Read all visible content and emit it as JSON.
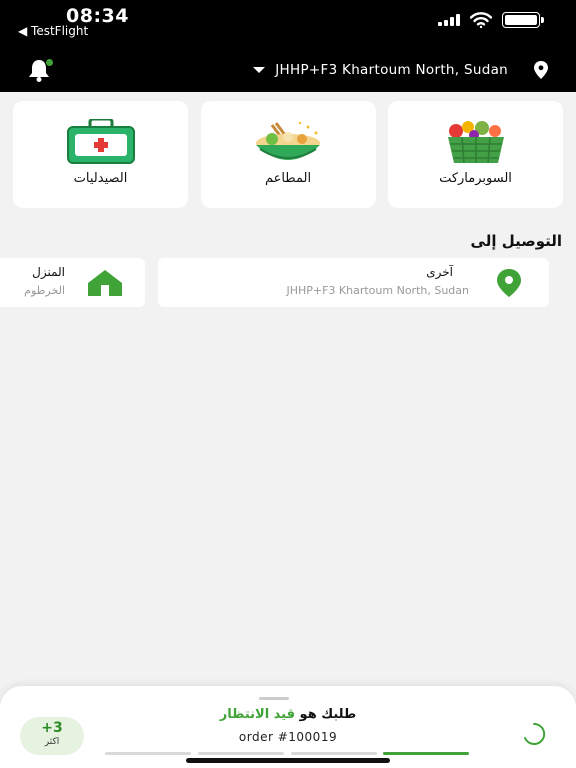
{
  "status_bar": {
    "time": "08:34",
    "back_label": "◀ TestFlight"
  },
  "header": {
    "location": "JHHP+F3 Khartoum North, Sudan",
    "notification_badge_color": "#3fa337"
  },
  "categories": [
    {
      "label": "الصيدليات",
      "icon": "first-aid-kit"
    },
    {
      "label": "المطاعم",
      "icon": "food-bowl"
    },
    {
      "label": "السوبرماركت",
      "icon": "grocery-basket"
    }
  ],
  "delivery": {
    "title": "التوصيل إلى",
    "addresses": [
      {
        "name": "آخرى",
        "detail": "JHHP+F3 Khartoum North, Sudan",
        "icon": "map-pin"
      },
      {
        "name": "المنزل",
        "detail": "الخرطوم",
        "icon": "home"
      }
    ]
  },
  "order_sheet": {
    "prefix": "طلبك هو",
    "status": "قيد الانتظار",
    "order_label": "order #100019",
    "more_count": "+3",
    "more_label": "اكثر",
    "progress_colors": [
      "#d9d9d9",
      "#d9d9d9",
      "#d9d9d9",
      "#3fa337"
    ]
  },
  "accent_color": "#3fa337"
}
